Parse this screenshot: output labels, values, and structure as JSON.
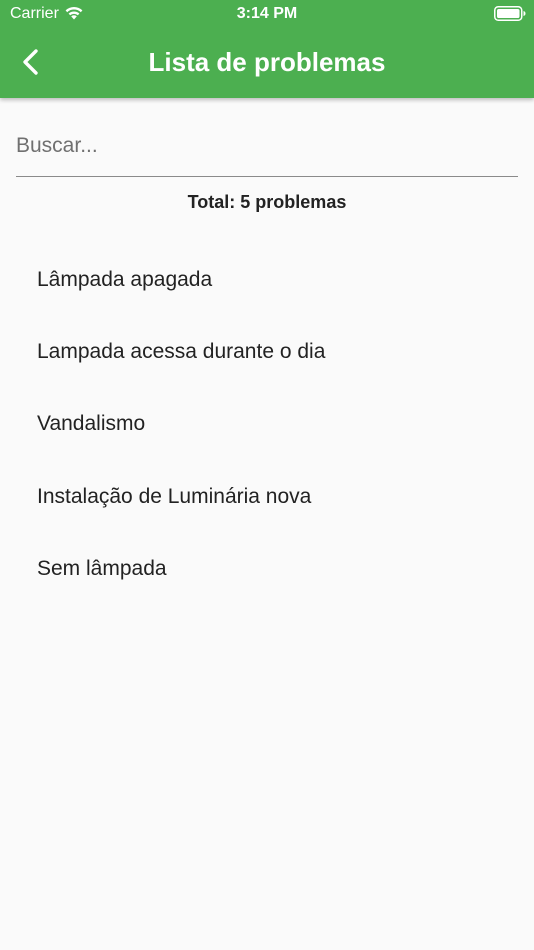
{
  "status_bar": {
    "carrier": "Carrier",
    "time": "3:14 PM"
  },
  "app_bar": {
    "title": "Lista de problemas",
    "background_color": "#4caf50"
  },
  "search": {
    "placeholder": "Buscar...",
    "value": ""
  },
  "summary": {
    "total_text": "Total: 5 problemas"
  },
  "problems": [
    {
      "label": "Lâmpada apagada"
    },
    {
      "label": "Lampada acessa durante o dia"
    },
    {
      "label": "Vandalismo"
    },
    {
      "label": "Instalação de Luminária nova"
    },
    {
      "label": "Sem lâmpada"
    }
  ],
  "icons": {
    "back": "chevron-left-icon",
    "wifi": "wifi-icon",
    "battery": "battery-icon"
  }
}
